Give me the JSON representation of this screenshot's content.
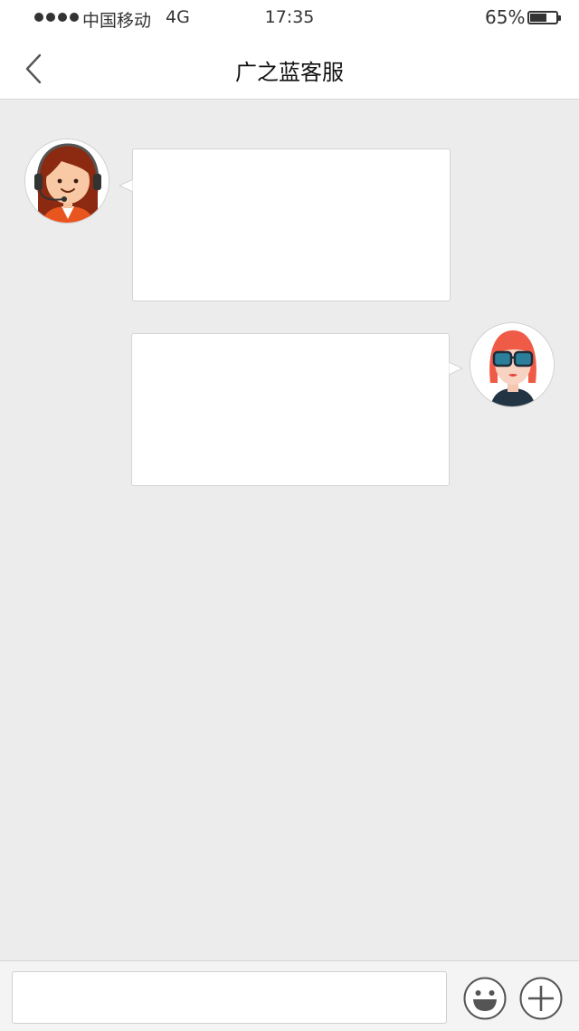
{
  "status_bar": {
    "carrier": "中国移动",
    "network": "4G",
    "time": "17:35",
    "battery_percent": "65%",
    "battery_level": 0.65
  },
  "nav": {
    "title": "广之蓝客服",
    "back_icon": "chevron-left-icon"
  },
  "conversation": {
    "messages": [
      {
        "sender": "agent",
        "avatar": "customer-service-agent-avatar",
        "text": ""
      },
      {
        "sender": "user",
        "avatar": "user-avatar",
        "text": ""
      }
    ]
  },
  "input_bar": {
    "placeholder": "",
    "emoji_icon": "smiley-face-icon",
    "more_icon": "plus-icon"
  },
  "colors": {
    "background": "#ececec",
    "bar": "#ffffff",
    "agent_hair": "#8b2a10",
    "user_hair": "#ef5b47"
  }
}
